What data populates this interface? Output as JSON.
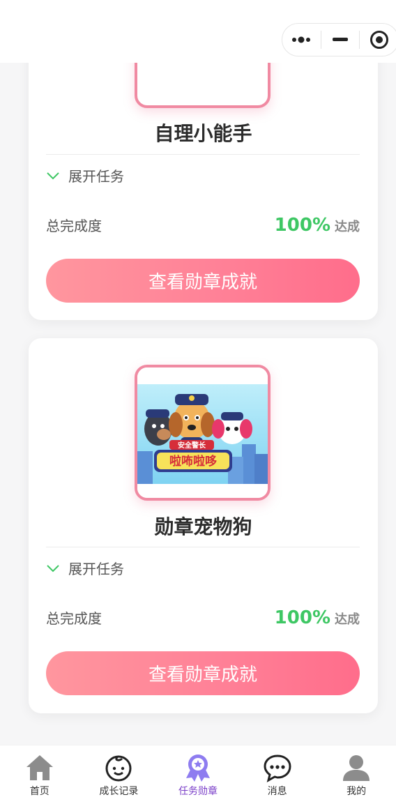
{
  "capsule": {
    "more_icon": "dots-icon",
    "minimize_icon": "minus-icon",
    "close_icon": "target-icon"
  },
  "cards": [
    {
      "title": "自理小能手",
      "expand_label": "展开任务",
      "progress_label": "总完成度",
      "progress_value": "100%",
      "progress_suffix": "达成",
      "button_label": "查看勋章成就"
    },
    {
      "title": "勋章宠物狗",
      "image_banner_text": "安全警长",
      "image_logo_text": "啦咘啦哆",
      "expand_label": "展开任务",
      "progress_label": "总完成度",
      "progress_value": "100%",
      "progress_suffix": "达成",
      "button_label": "查看勋章成就"
    }
  ],
  "tabbar": {
    "items": [
      {
        "label": "首页",
        "icon": "home-icon"
      },
      {
        "label": "成长记录",
        "icon": "baby-face-icon"
      },
      {
        "label": "任务勋章",
        "icon": "medal-icon",
        "active": true
      },
      {
        "label": "消息",
        "icon": "chat-bubble-icon"
      },
      {
        "label": "我的",
        "icon": "user-icon"
      }
    ],
    "active_color": "#7a3ec8"
  },
  "colors": {
    "accent_green": "#3ec764",
    "button_pink": "#ff7f95",
    "frame_pink": "#f08aa2"
  }
}
